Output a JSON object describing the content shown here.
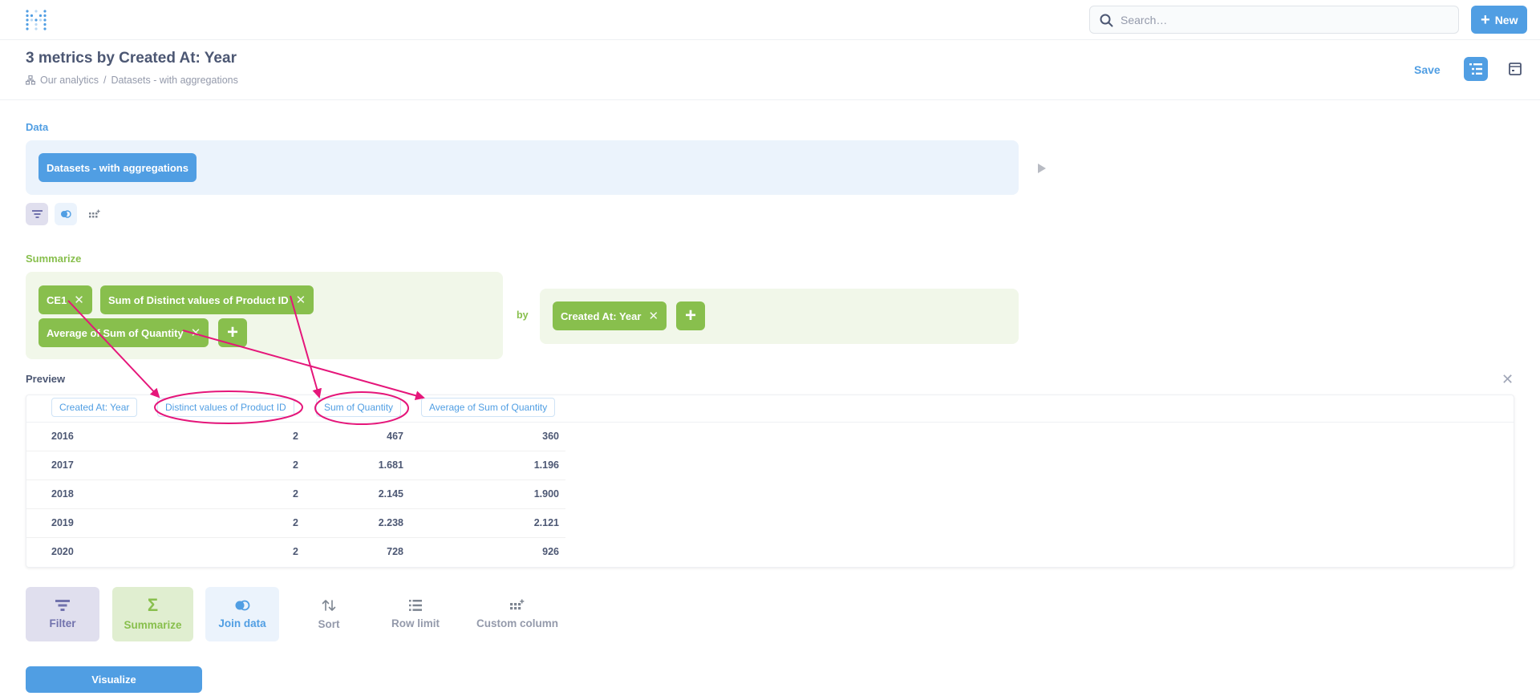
{
  "nav": {
    "search_placeholder": "Search…",
    "new_label": "New"
  },
  "header": {
    "title": "3 metrics by Created At: Year",
    "breadcrumb": [
      "Our analytics",
      "Datasets - with aggregations"
    ],
    "save_label": "Save"
  },
  "data_step": {
    "label": "Data",
    "source": "Datasets - with aggregations"
  },
  "summarize_step": {
    "label": "Summarize",
    "metrics": [
      "CE1",
      "Sum of Distinct values of Product ID",
      "Average of Sum of Quantity"
    ],
    "by_label": "by",
    "breakouts": [
      "Created At: Year"
    ]
  },
  "preview": {
    "label": "Preview",
    "columns": [
      "Created At: Year",
      "Distinct values of Product ID",
      "Sum of Quantity",
      "Average of Sum of Quantity"
    ],
    "rows": [
      [
        "2016",
        "2",
        "467",
        "360"
      ],
      [
        "2017",
        "2",
        "1.681",
        "1.196"
      ],
      [
        "2018",
        "2",
        "2.145",
        "1.900"
      ],
      [
        "2019",
        "2",
        "2.238",
        "2.121"
      ],
      [
        "2020",
        "2",
        "728",
        "926"
      ]
    ]
  },
  "actions": {
    "filter": "Filter",
    "summarize": "Summarize",
    "join": "Join data",
    "sort": "Sort",
    "row_limit": "Row limit",
    "custom_column": "Custom column"
  },
  "visualize_label": "Visualize",
  "colors": {
    "brand": "#509ee3",
    "summarize": "#88bf4d",
    "filter": "#7172ad",
    "annotation": "#e5167a"
  }
}
